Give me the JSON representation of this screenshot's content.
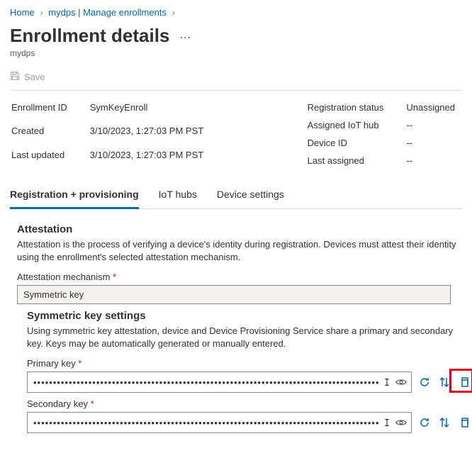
{
  "breadcrumb": {
    "home": "Home",
    "mid": "mydps | Manage enrollments"
  },
  "page": {
    "title": "Enrollment details",
    "subtitle": "mydps"
  },
  "toolbar": {
    "save": "Save"
  },
  "propsLeft": {
    "enrollmentId": {
      "label": "Enrollment ID",
      "value": "SymKeyEnroll"
    },
    "created": {
      "label": "Created",
      "value": "3/10/2023, 1:27:03 PM PST"
    },
    "lastUpdated": {
      "label": "Last updated",
      "value": "3/10/2023, 1:27:03 PM PST"
    }
  },
  "propsRight": {
    "regStatus": {
      "label": "Registration status",
      "value": "Unassigned"
    },
    "assignedHub": {
      "label": "Assigned IoT hub",
      "value": "--"
    },
    "deviceId": {
      "label": "Device ID",
      "value": "--"
    },
    "lastAssigned": {
      "label": "Last assigned",
      "value": "--"
    }
  },
  "tabs": {
    "reg": "Registration + provisioning",
    "iot": "IoT hubs",
    "dev": "Device settings"
  },
  "attestation": {
    "heading": "Attestation",
    "desc": "Attestation is the process of verifying a device's identity during registration. Devices must attest their identity using the enrollment's selected attestation mechanism.",
    "mechLabel": "Attestation mechanism",
    "mechValue": "Symmetric key"
  },
  "symKey": {
    "heading": "Symmetric key settings",
    "desc": "Using symmetric key attestation, device and Device Provisioning Service share a primary and secondary key. Keys may be automatically generated or manually entered.",
    "primaryLabel": "Primary key",
    "secondaryLabel": "Secondary key",
    "masked": "••••••••••••••••••••••••••••••••••••••••••••••••••••••••••••••••••••••••••••••••••••••••"
  }
}
